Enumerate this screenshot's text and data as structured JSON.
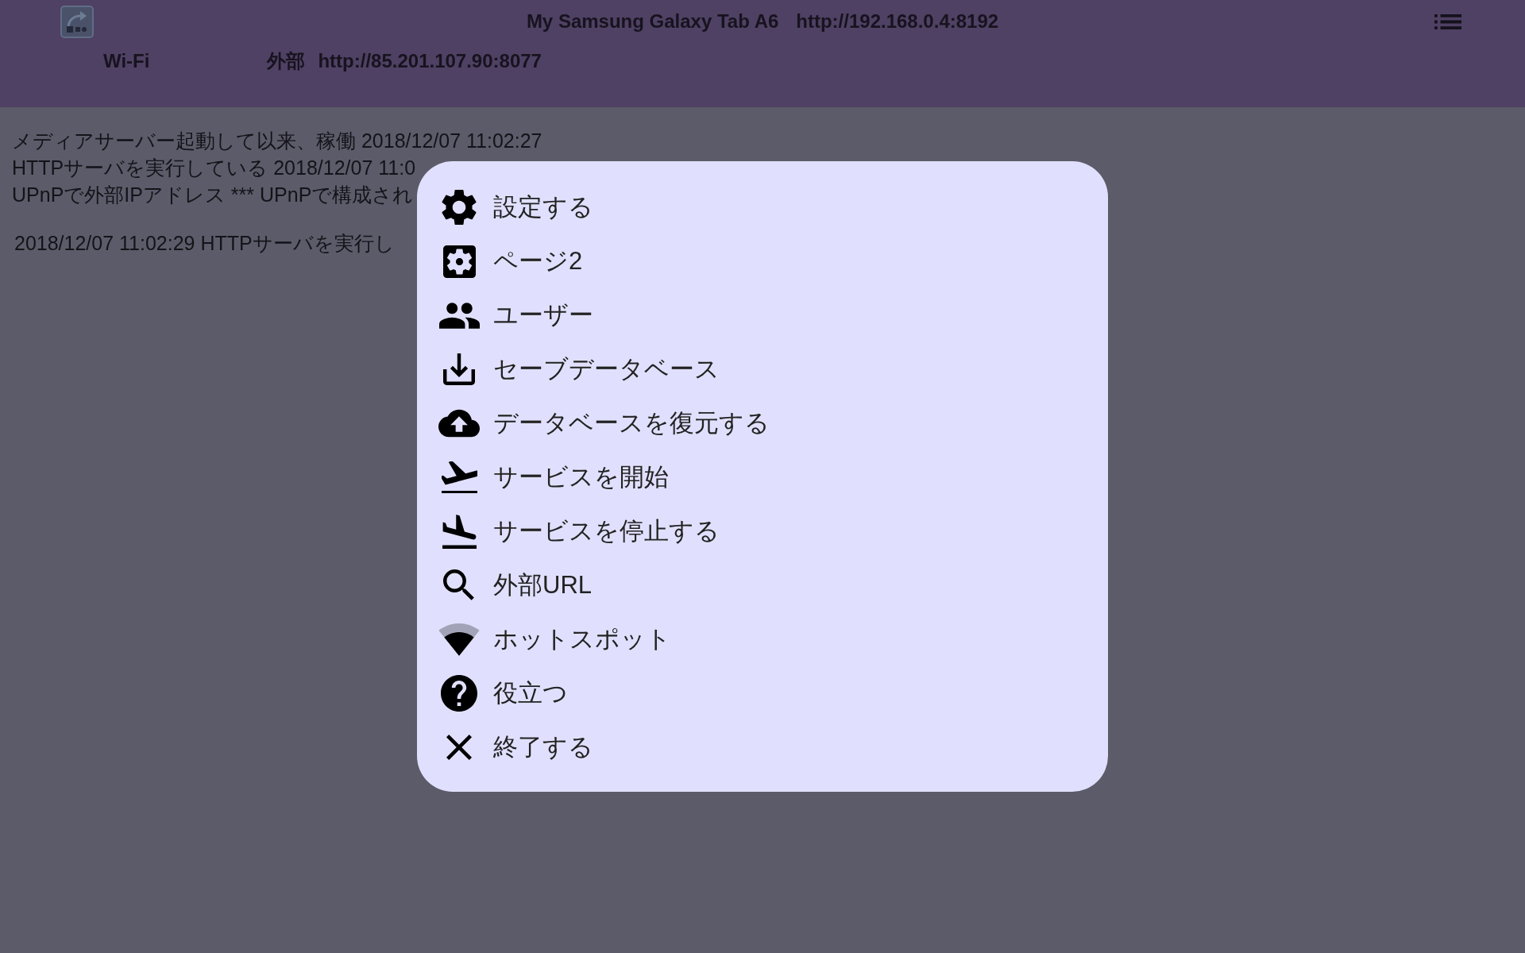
{
  "header": {
    "device_name": "My Samsung Galaxy Tab A6",
    "local_url": "http://192.168.0.4:8192",
    "network": "Wi-Fi",
    "external_label": "外部",
    "external_url": "http://85.201.107.90:8077"
  },
  "status_lines": [
    "メディアサーバー起動して以来、稼働 2018/12/07 11:02:27",
    "HTTPサーバを実行している 2018/12/07 11:0",
    "UPnPで外部IPアドレス *** UPnPで構成され"
  ],
  "log_entries": [
    "2018/12/07 11:02:29 HTTPサーバを実行し"
  ],
  "menu": {
    "items": [
      {
        "label": "設定する"
      },
      {
        "label": "ページ2"
      },
      {
        "label": "ユーザー"
      },
      {
        "label": "セーブデータベース"
      },
      {
        "label": "データベースを復元する"
      },
      {
        "label": "サービスを開始"
      },
      {
        "label": "サービスを停止する"
      },
      {
        "label": "外部URL"
      },
      {
        "label": "ホットスポット"
      },
      {
        "label": "役立つ"
      },
      {
        "label": "終了する"
      }
    ]
  }
}
